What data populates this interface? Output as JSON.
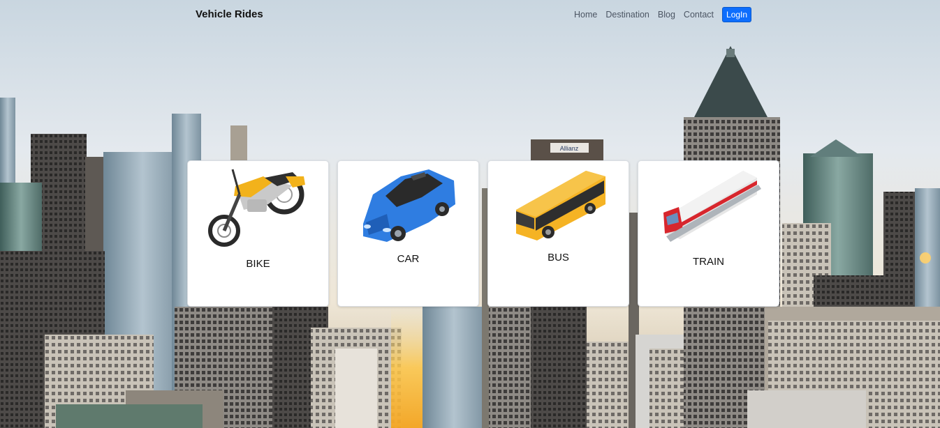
{
  "navbar": {
    "brand": "Vehicle Rides",
    "links": [
      "Home",
      "Destination",
      "Blog",
      "Contact"
    ],
    "login_label": "LogIn",
    "login_color": "#0d6efd"
  },
  "cards": [
    {
      "label": "BIKE",
      "icon": "motorbike-icon",
      "color": "#f2b21b"
    },
    {
      "label": "CAR",
      "icon": "car-icon",
      "color": "#2f7de1"
    },
    {
      "label": "BUS",
      "icon": "bus-icon",
      "color": "#f5b324"
    },
    {
      "label": "TRAIN",
      "icon": "train-icon",
      "color": "#d7262d"
    }
  ],
  "background": {
    "sign_text": "Allianz"
  }
}
